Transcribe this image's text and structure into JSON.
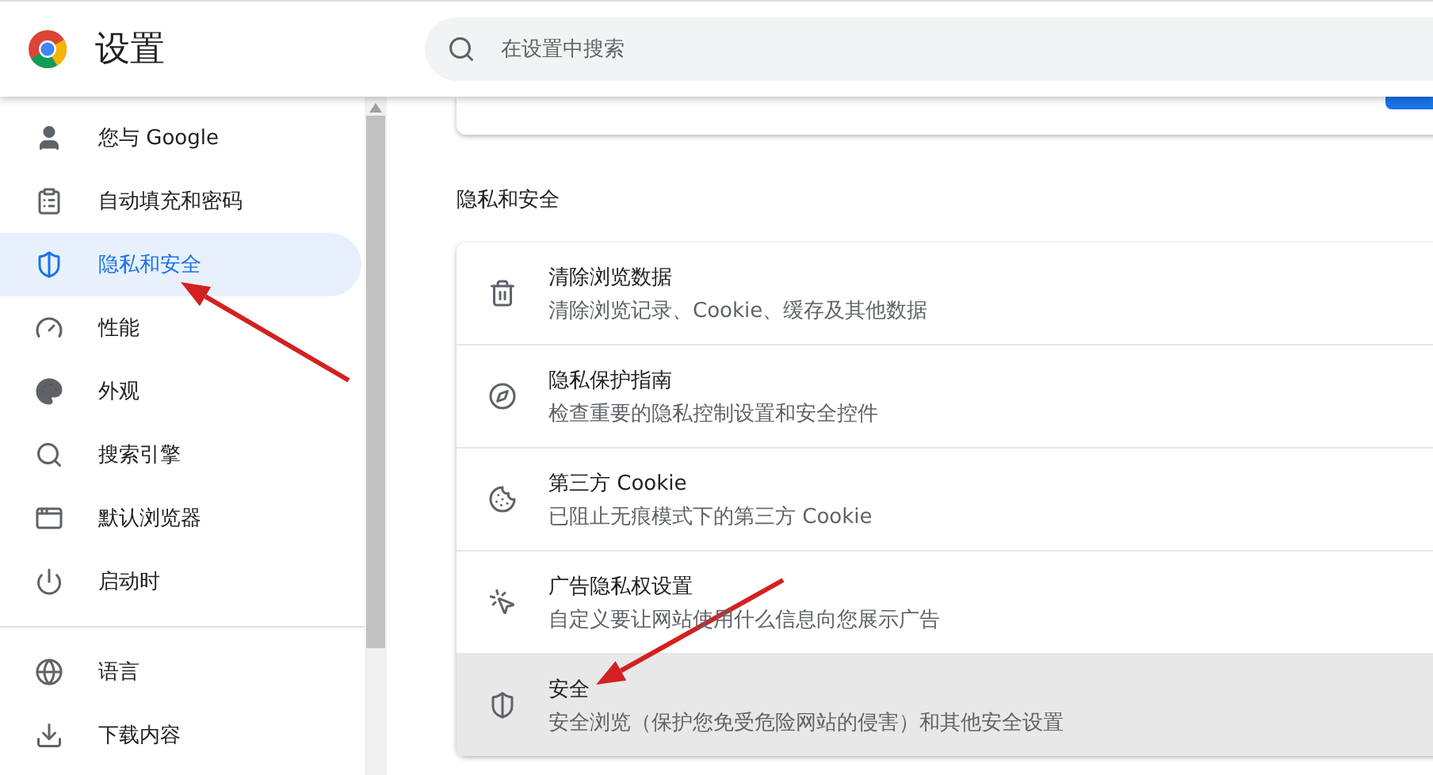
{
  "header": {
    "title": "设置",
    "search": {
      "placeholder": "在设置中搜索"
    }
  },
  "sidebar": {
    "sections": [
      [
        {
          "label": "您与 Google",
          "selected": false
        },
        {
          "label": "自动填充和密码",
          "selected": false
        },
        {
          "label": "隐私和安全",
          "selected": true
        },
        {
          "label": "性能",
          "selected": false
        },
        {
          "label": "外观",
          "selected": false
        },
        {
          "label": "搜索引擎",
          "selected": false
        },
        {
          "label": "默认浏览器",
          "selected": false
        },
        {
          "label": "启动时",
          "selected": false
        }
      ],
      [
        {
          "label": "语言",
          "selected": false
        },
        {
          "label": "下载内容",
          "selected": false
        }
      ]
    ]
  },
  "section": {
    "title": "隐私和安全",
    "rows": [
      {
        "title": "清除浏览数据",
        "subtitle": "清除浏览记录、Cookie、缓存及其他数据",
        "hovered": false
      },
      {
        "title": "隐私保护指南",
        "subtitle": "检查重要的隐私控制设置和安全控件",
        "hovered": false
      },
      {
        "title": "第三方 Cookie",
        "subtitle": "已阻止无痕模式下的第三方 Cookie",
        "hovered": false
      },
      {
        "title": "广告隐私权设置",
        "subtitle": "自定义要让网站使用什么信息向您展示广告",
        "hovered": false
      },
      {
        "title": "安全",
        "subtitle": "安全浏览（保护您免受危险网站的侵害）和其他安全设置",
        "hovered": true
      }
    ]
  }
}
